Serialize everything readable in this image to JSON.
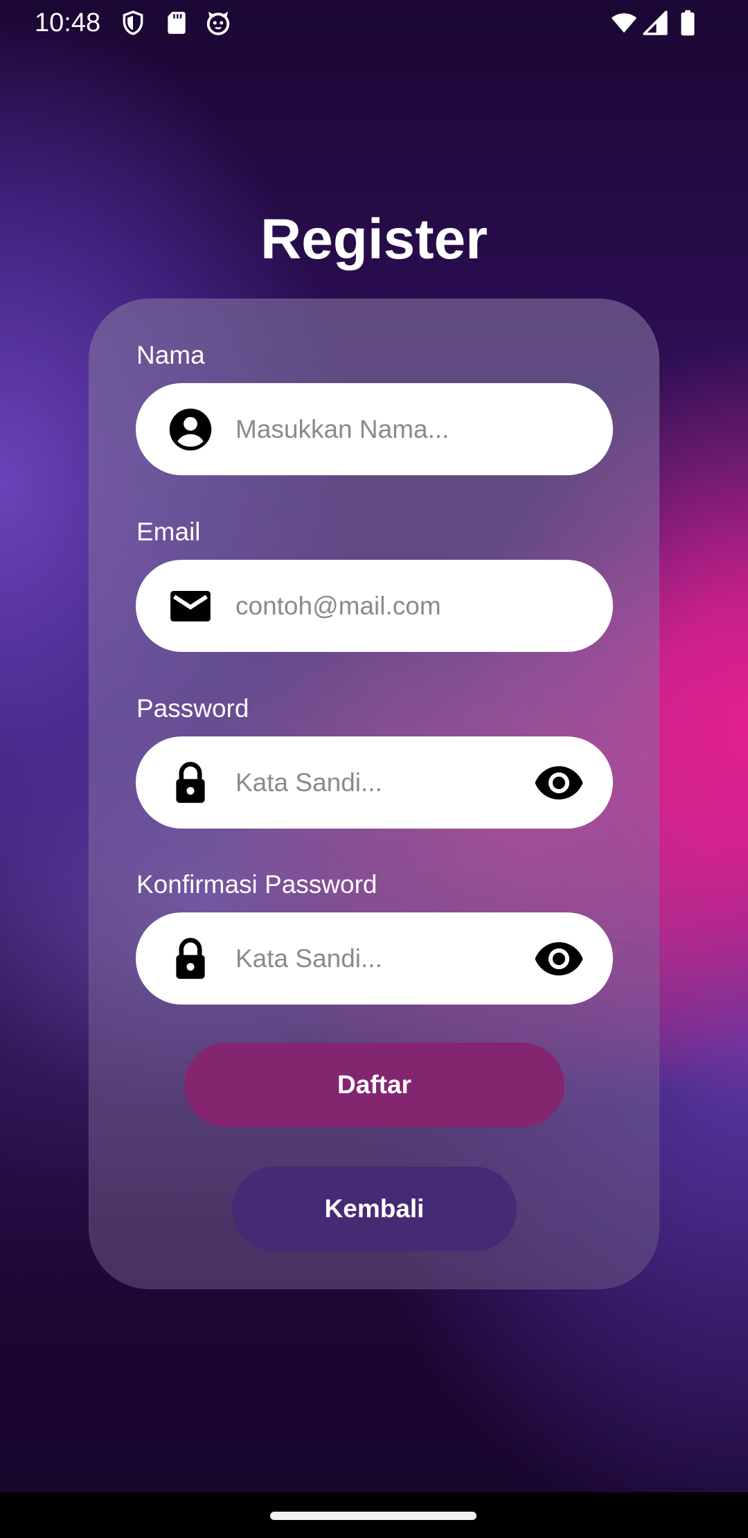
{
  "status_bar": {
    "time": "10:48",
    "icons": [
      "shield-icon",
      "sd-card-icon",
      "cat-face-icon",
      "wifi-icon",
      "signal-icon",
      "battery-icon"
    ]
  },
  "title": "Register",
  "form": {
    "name": {
      "label": "Nama",
      "placeholder": "Masukkan Nama...",
      "value": "",
      "icon": "account-circle-icon"
    },
    "email": {
      "label": "Email",
      "placeholder": "contoh@mail.com",
      "value": "",
      "icon": "mail-icon"
    },
    "password": {
      "label": "Password",
      "placeholder": "Kata Sandi...",
      "value": "",
      "icon": "lock-icon",
      "toggle_icon": "eye-icon"
    },
    "confirm_password": {
      "label": "Konfirmasi Password",
      "placeholder": "Kata Sandi...",
      "value": "",
      "icon": "lock-icon",
      "toggle_icon": "eye-icon"
    }
  },
  "buttons": {
    "register_label": "Daftar",
    "back_label": "Kembali"
  },
  "colors": {
    "register_button": "#84266f",
    "back_button": "#452a74",
    "field_background": "#ffffff",
    "text_primary": "#ffffff",
    "placeholder": "#8a8a8a"
  }
}
